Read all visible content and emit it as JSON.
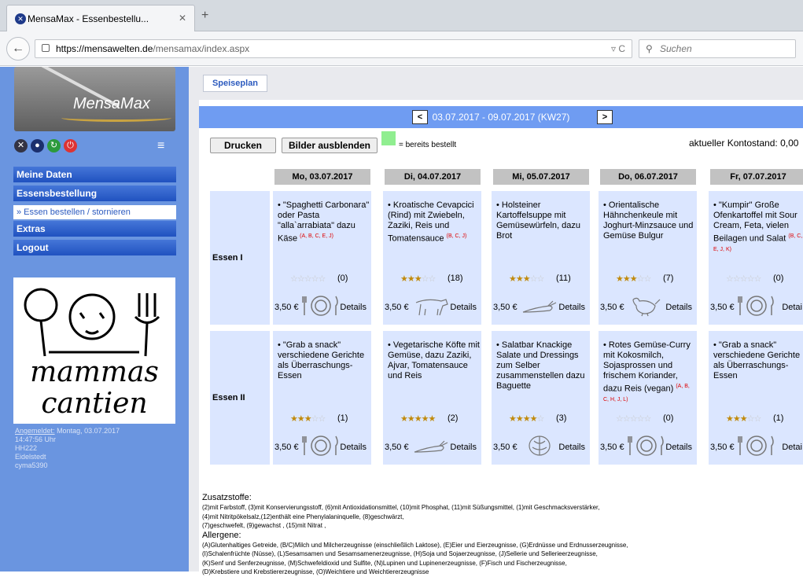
{
  "browser": {
    "tab_title": "MensaMax - Essenbestellu...",
    "url_host": "https://mensawelten.de",
    "url_path": "/mensamax/index.aspx",
    "search_placeholder": "Suchen"
  },
  "sidebar": {
    "logo_text": "MensaMax",
    "menu": [
      "Meine Daten",
      "Essensbestellung",
      "» Essen bestellen / stornieren",
      "Extras",
      "Logout"
    ],
    "kids_logo": [
      "mammas",
      "cantien"
    ],
    "login": {
      "label": "Angemeldet:",
      "lines": [
        "Montag, 03.07.2017",
        "14:47:56 Uhr",
        "HH222",
        "Eidelstedt",
        "cyma5390"
      ]
    }
  },
  "content": {
    "crumb": "Speiseplan",
    "week": "03.07.2017 - 09.07.2017 (KW27)",
    "prev": "<",
    "next": ">",
    "print_btn": "Drucken",
    "hide_btn": "Bilder ausblenden",
    "legend": "= bereits bestellt",
    "balance": "aktueller Kontostand: 0,00",
    "days": [
      "Mo, 03.07.2017",
      "Di, 04.07.2017",
      "Mi, 05.07.2017",
      "Do, 06.07.2017",
      "Fr, 07.07.2017"
    ],
    "rows": [
      "Essen I",
      "Essen II"
    ]
  },
  "menu_items": [
    [
      {
        "text": "• \"Spaghetti Carbonara\" oder Pasta \"alla`arrabiata\" dazu Käse",
        "sup": "(A, B, C, E, J)",
        "stars": 0,
        "count": "(0)",
        "price": "3,50 €",
        "pic": "plate",
        "det": "Details"
      },
      {
        "text": "• Kroatische Cevapcici (Rind) mit Zwiebeln, Zaziki, Reis und Tomatensauce",
        "sup": "(B, C, J)",
        "stars": 3,
        "count": "(18)",
        "price": "3,50 €",
        "pic": "cow",
        "det": "Details"
      },
      {
        "text": "• Holsteiner Kartoffelsuppe mit Gemüsewürfeln, dazu Brot",
        "sup": "",
        "stars": 3,
        "count": "(11)",
        "price": "3,50 €",
        "pic": "carrot",
        "det": "Details"
      },
      {
        "text": "• Orientalische Hähnchenkeule mit Joghurt-Minzsauce und Gemüse Bulgur",
        "sup": "",
        "stars": 3,
        "count": "(7)",
        "price": "3,50 €",
        "pic": "chicken",
        "det": "Details"
      },
      {
        "text": "• \"Kumpir\" Große Ofenkartoffel mit Sour Cream, Feta, vielen Beilagen und Salat",
        "sup": "(B, C, E, J, K)",
        "stars": 0,
        "count": "(0)",
        "price": "3,50 €",
        "pic": "plate",
        "det": "Detai"
      }
    ],
    [
      {
        "text": "• \"Grab a snack\" verschiedene Gerichte als Überraschungs-Essen",
        "sup": "",
        "stars": 3,
        "count": "(1)",
        "price": "3,50 €",
        "pic": "plate",
        "det": "Details"
      },
      {
        "text": "• Vegetarische Köfte mit Gemüse, dazu Zaziki, Ajvar, Tomatensauce und Reis",
        "sup": "",
        "stars": 4.5,
        "count": "(2)",
        "price": "3,50 €",
        "pic": "carrot",
        "det": "Details"
      },
      {
        "text": "• Salatbar Knackige Salate und Dressings zum Selber zusammenstellen dazu Baguette",
        "sup": "",
        "stars": 4,
        "count": "(3)",
        "price": "3,50 €",
        "pic": "lettuce",
        "det": "Details"
      },
      {
        "text": "• Rotes Gemüse-Curry mit Kokosmilch, Sojasprossen und frischem Koriander, dazu Reis (vegan)",
        "sup": "(A, B, C, H, J, L)",
        "stars": 0,
        "count": "(0)",
        "price": "3,50 €",
        "pic": "plate",
        "det": "Details"
      },
      {
        "text": "• \"Grab a snack\" verschiedene Gerichte als Überraschungs-Essen",
        "sup": "",
        "stars": 3,
        "count": "(1)",
        "price": "3,50 €",
        "pic": "plate",
        "det": "Detai"
      }
    ]
  ],
  "notes": {
    "zusatz_title": "Zusatzstoffe:",
    "zusatz": [
      "(2)mit Farbstoff, (3)mit Konservierungsstoff, (6)mit Antioxidationsmittel, (10)mit Phosphat, (11)mit Süßungsmittel, (1)mit Geschmacksverstärker,",
      "(4)mit Nitritpökelsalz,(12)enthält eine Phenylalaninquelle, (8)geschwärzt,",
      "(7)geschwefelt, (9)gewachst , (15)mit Nitrat ,"
    ],
    "allergen_title": "Allergene:",
    "allergene": [
      "(A)Glutenhaltiges Getreide, (B/C)Milch und Milcherzeugnisse (einschließlich Laktose), (E)Eier und Eierzeugnisse, (G)Erdnüsse und Erdnusserzeugnisse,",
      "(I)Schalenfrüchte (Nüsse), (L)Sesamsamen und Sesamsamenerzeugnisse, (H)Soja und Sojaerzeugnisse, (J)Sellerie und Sellerieerzeugnisse,",
      "(K)Senf und Senferzeugnisse, (M)Schwefeldioxid und Sulfite, (N)Lupinen und Lupinenerzeugnisse, (F)Fisch und Fischerzeugnisse,",
      "(D)Krebstiere und Krebstiererzeugnisse, (O)Weichtiere und Weichtiererzeugnisse"
    ]
  }
}
